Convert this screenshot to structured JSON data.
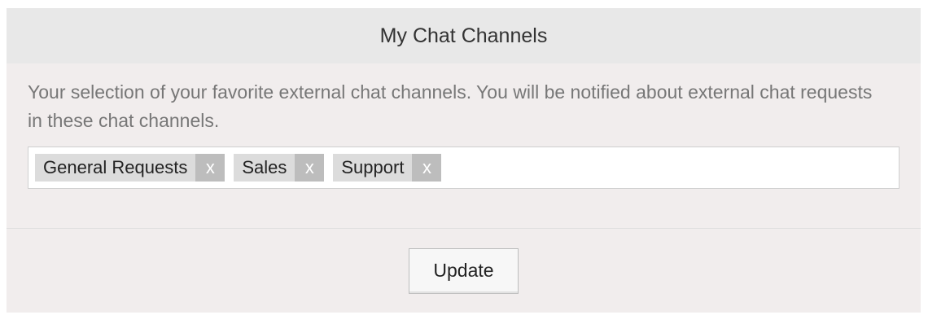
{
  "panel": {
    "title": "My Chat Channels",
    "description": "Your selection of your favorite external chat channels. You will be notified about external chat requests in these chat channels."
  },
  "channels": {
    "tags": [
      {
        "label": "General Requests",
        "remove": "x"
      },
      {
        "label": "Sales",
        "remove": "x"
      },
      {
        "label": "Support",
        "remove": "x"
      }
    ],
    "input_value": ""
  },
  "footer": {
    "update_label": "Update"
  },
  "colors": {
    "panel_background": "#f1eded",
    "header_background": "#e8e8e8",
    "tag_background": "#dcdcdc",
    "tag_remove_background": "#bdbdbd"
  }
}
